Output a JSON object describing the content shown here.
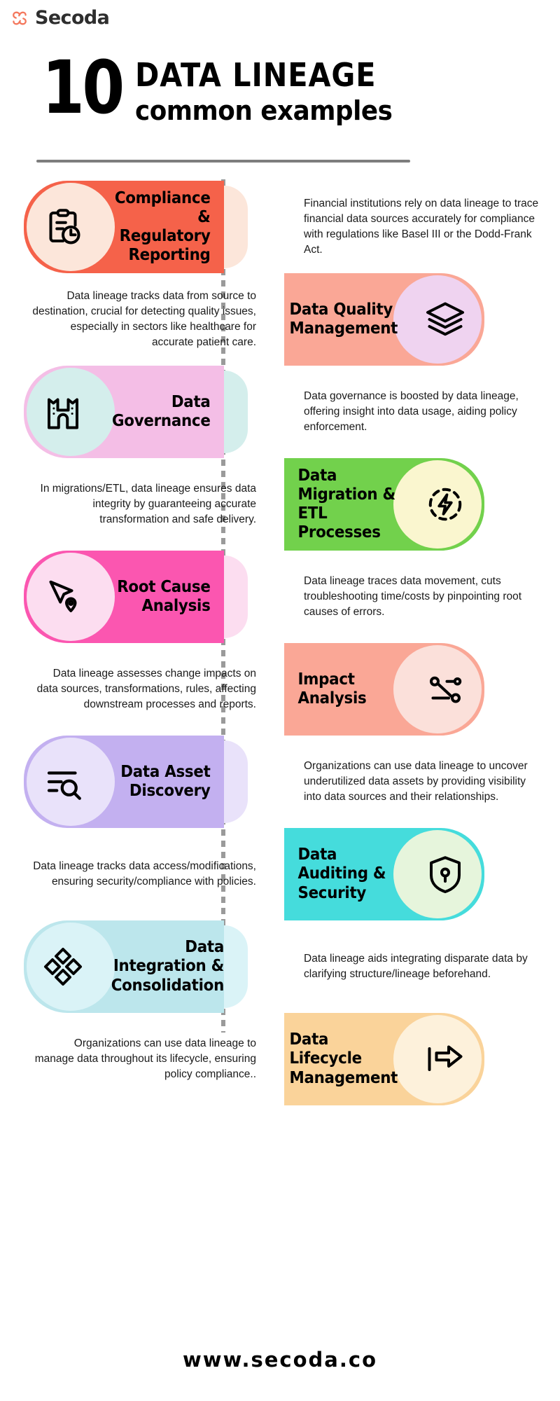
{
  "brand": {
    "name": "Secoda",
    "logo_icon": "secoda-knot-logo",
    "logo_color": "#F4775C"
  },
  "headline": {
    "number": "10",
    "main": "DATA LINEAGE",
    "sub": "common examples"
  },
  "footer": {
    "url": "www.secoda.co"
  },
  "items": [
    {
      "index": 1,
      "side": "left",
      "title": "Compliance & Regulatory Reporting",
      "description": "Financial institutions rely on data lineage to trace financial data sources accurately for compliance with regulations like Basel III or the Dodd-Frank Act.",
      "icon": "clipboard-clock-icon",
      "pill_color": "#F5624A",
      "halo_color": "#FCE6DA"
    },
    {
      "index": 2,
      "side": "right",
      "title": "Data Quality Management",
      "description": "Data lineage tracks data from source to destination, crucial for detecting quality issues, especially in sectors like healthcare for accurate patient care.",
      "icon": "stacked-layers-icon",
      "pill_color": "#FAA796",
      "halo_color": "#EFD3F0"
    },
    {
      "index": 3,
      "side": "left",
      "title": "Data Governance",
      "description": "Data governance is boosted by data lineage, offering insight into data usage, aiding policy enforcement.",
      "icon": "fortress-icon",
      "pill_color": "#F4BEE6",
      "halo_color": "#D4EEEC"
    },
    {
      "index": 4,
      "side": "right",
      "title": "Data Migration & ETL Processes",
      "description": "In migrations/ETL, data lineage ensures data integrity by guaranteeing accurate transformation and safe delivery.",
      "icon": "dashed-circle-bolt-icon",
      "pill_color": "#72D14C",
      "halo_color": "#FAF6CF"
    },
    {
      "index": 5,
      "side": "left",
      "title": "Root Cause Analysis",
      "description": "Data lineage traces data movement, cuts troubleshooting time/costs by pinpointing root causes of errors.",
      "icon": "cursor-pin-icon",
      "pill_color": "#FB56B0",
      "halo_color": "#FCDDF0"
    },
    {
      "index": 6,
      "side": "right",
      "title": "Impact Analysis",
      "description": "Data lineage assesses change impacts on data sources, transformations, rules, affecting downstream processes and reports.",
      "icon": "node-graph-icon",
      "pill_color": "#FAA796",
      "halo_color": "#FBE0DA"
    },
    {
      "index": 7,
      "side": "left",
      "title": "Data Asset Discovery",
      "description": "Organizations can use data lineage to uncover underutilized data assets by providing visibility into data sources and their relationships.",
      "icon": "list-search-icon",
      "pill_color": "#C3B0F0",
      "halo_color": "#E9E2FA"
    },
    {
      "index": 8,
      "side": "right",
      "title": "Data Auditing & Security",
      "description": "Data lineage tracks data access/modifications, ensuring security/compliance with policies.",
      "icon": "shield-lock-icon",
      "pill_color": "#45DCDC",
      "halo_color": "#E6F5DC"
    },
    {
      "index": 9,
      "side": "left",
      "title": "Data Integration & Consolidation",
      "description": "Data lineage aids integrating disparate data by clarifying structure/lineage beforehand.",
      "icon": "four-diamonds-icon",
      "pill_color": "#BCE6EC",
      "halo_color": "#DAF3F7"
    },
    {
      "index": 10,
      "side": "right",
      "title": "Data Lifecycle Management",
      "description": "Organizations can use data lineage to manage data throughout its lifecycle, ensuring policy compliance..",
      "icon": "arrow-hand-icon",
      "pill_color": "#FAD39A",
      "halo_color": "#FDF1DB"
    }
  ]
}
